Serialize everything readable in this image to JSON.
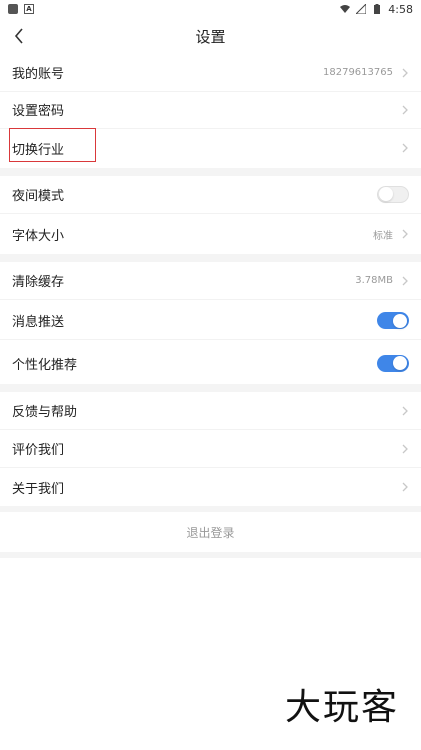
{
  "status_bar": {
    "time": "4:58"
  },
  "header": {
    "title": "设置"
  },
  "rows": {
    "account": {
      "label": "我的账号",
      "value": "18279613765"
    },
    "password": {
      "label": "设置密码"
    },
    "industry": {
      "label": "切换行业"
    },
    "night_mode": {
      "label": "夜间模式",
      "toggle": false
    },
    "font_size": {
      "label": "字体大小",
      "value": "标准"
    },
    "cache": {
      "label": "清除缓存",
      "value": "3.78MB"
    },
    "push": {
      "label": "消息推送",
      "toggle": true
    },
    "recommend": {
      "label": "个性化推荐",
      "toggle": true
    },
    "feedback": {
      "label": "反馈与帮助"
    },
    "rate": {
      "label": "评价我们"
    },
    "about": {
      "label": "关于我们"
    }
  },
  "logout_label": "退出登录",
  "watermark": "大玩客",
  "colors": {
    "toggle_on": "#3f86e8",
    "highlight": "#d9383a"
  }
}
